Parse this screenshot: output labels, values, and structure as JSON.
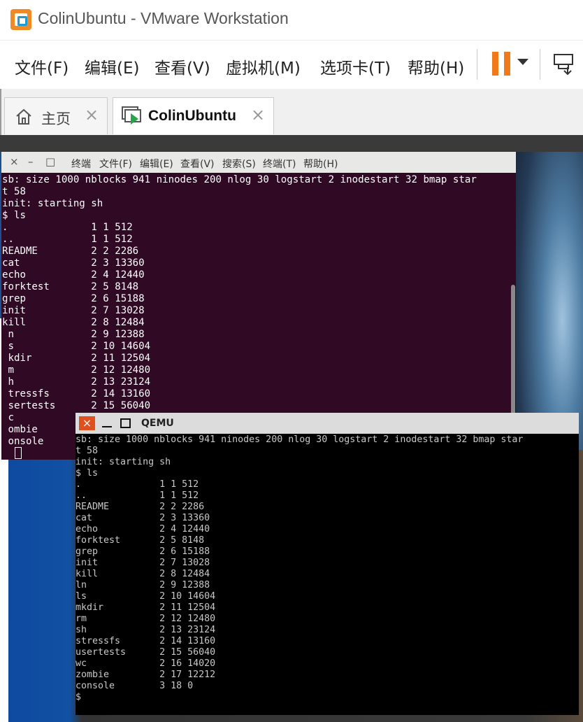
{
  "window": {
    "title": "ColinUbuntu - VMware Workstation"
  },
  "menu": [
    "文件(F)",
    "编辑(E)",
    "查看(V)",
    "虚拟机(M)",
    "选项卡(T)",
    "帮助(H)"
  ],
  "tabs": [
    {
      "label": "主页",
      "close": "×"
    },
    {
      "label": "ColinUbuntu",
      "close": "×"
    }
  ],
  "terminal": {
    "controls": [
      "×",
      "–",
      "□"
    ],
    "menu": [
      "终端",
      "文件(F)",
      "编辑(E)",
      "查看(V)",
      "搜索(S)",
      "终端(T)",
      "帮助(H)"
    ],
    "lines": [
      "sb: size 1000 nblocks 941 ninodes 200 nlog 30 logstart 2 inodestart 32 bmap star",
      "t 58",
      "init: starting sh",
      "$ ls",
      ".              1 1 512",
      "..             1 1 512",
      "README         2 2 2286",
      "cat            2 3 13360",
      "echo           2 4 12440",
      "forktest       2 5 8148",
      "grep           2 6 15188",
      "init           2 7 13028",
      "kill           2 8 12484",
      " n             2 9 12388",
      " s             2 10 14604",
      " kdir          2 11 12504",
      " m             2 12 12480",
      " h             2 13 23124",
      " tressfs       2 14 13160",
      " sertests      2 15 56040",
      " c",
      " ombie",
      " onsole"
    ]
  },
  "qemu": {
    "title": "QEMU",
    "close": "×",
    "lines": [
      "sb: size 1000 nblocks 941 ninodes 200 nlog 30 logstart 2 inodestart 32 bmap star",
      "t 58",
      "init: starting sh",
      "$ ls",
      ".              1 1 512",
      "..             1 1 512",
      "README         2 2 2286",
      "cat            2 3 13360",
      "echo           2 4 12440",
      "forktest       2 5 8148",
      "grep           2 6 15188",
      "init           2 7 13028",
      "kill           2 8 12484",
      "ln             2 9 12388",
      "ls             2 10 14604",
      "mkdir          2 11 12504",
      "rm             2 12 12480",
      "sh             2 13 23124",
      "stressfs       2 14 13160",
      "usertests      2 15 56040",
      "wc             2 16 14020",
      "zombie         2 17 12212",
      "console        3 18 0",
      "$"
    ]
  },
  "colors": {
    "terminal_bg": "#300a24",
    "pause": "#f07a1a",
    "qemu_close": "#e0501e"
  }
}
